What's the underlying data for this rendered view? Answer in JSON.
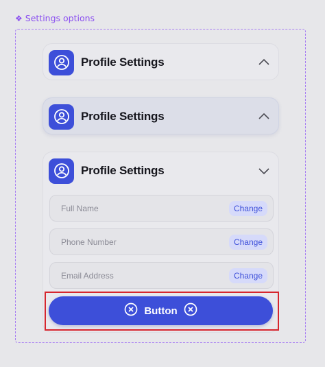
{
  "frame": {
    "label": "Settings options",
    "label_icon": "diamond-component-icon"
  },
  "cards": [
    {
      "title": "Profile Settings",
      "state": "collapsed",
      "chevron": "chevron-up-icon"
    },
    {
      "title": "Profile Settings",
      "state": "hover",
      "chevron": "chevron-up-icon"
    },
    {
      "title": "Profile Settings",
      "state": "expanded",
      "chevron": "chevron-down-icon",
      "fields": [
        {
          "placeholder": "Full Name",
          "action": "Change"
        },
        {
          "placeholder": "Phone Number",
          "action": "Change"
        },
        {
          "placeholder": "Email Address",
          "action": "Change"
        }
      ]
    }
  ],
  "button": {
    "label": "Button",
    "left_icon": "close-circle-icon",
    "right_icon": "close-circle-icon"
  },
  "colors": {
    "accent": "#3d4fd9",
    "frame": "#a77df3",
    "highlight": "#d6262e",
    "background": "#e7e7ea"
  }
}
